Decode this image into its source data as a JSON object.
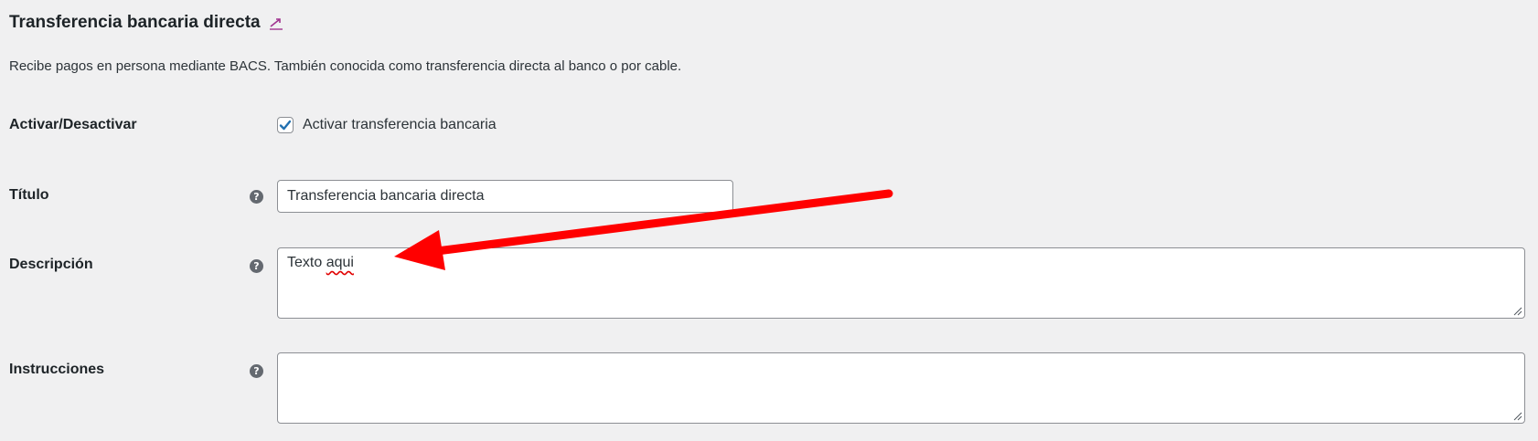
{
  "section": {
    "title": "Transferencia bancaria directa",
    "return_icon": "up-arrow-return-icon",
    "description": "Recibe pagos en persona mediante BACS. También conocida como transferencia directa al banco o por cable."
  },
  "fields": {
    "enable": {
      "label": "Activar/Desactivar",
      "checkbox_label": "Activar transferencia bancaria",
      "checked": true
    },
    "title": {
      "label": "Título",
      "value": "Transferencia bancaria directa",
      "help_icon": "help-icon"
    },
    "description": {
      "label": "Descripción",
      "value_word1": "Texto",
      "value_word2": "aqui",
      "help_icon": "help-icon"
    },
    "instructions": {
      "label": "Instrucciones",
      "value": "",
      "help_icon": "help-icon"
    }
  },
  "annotation": {
    "type": "red-arrow",
    "color": "#ff0000"
  },
  "colors": {
    "background": "#f0f0f1",
    "checkbox_accent": "#2271b1",
    "link_accent": "#a0338f",
    "arrow": "#ff0000"
  }
}
